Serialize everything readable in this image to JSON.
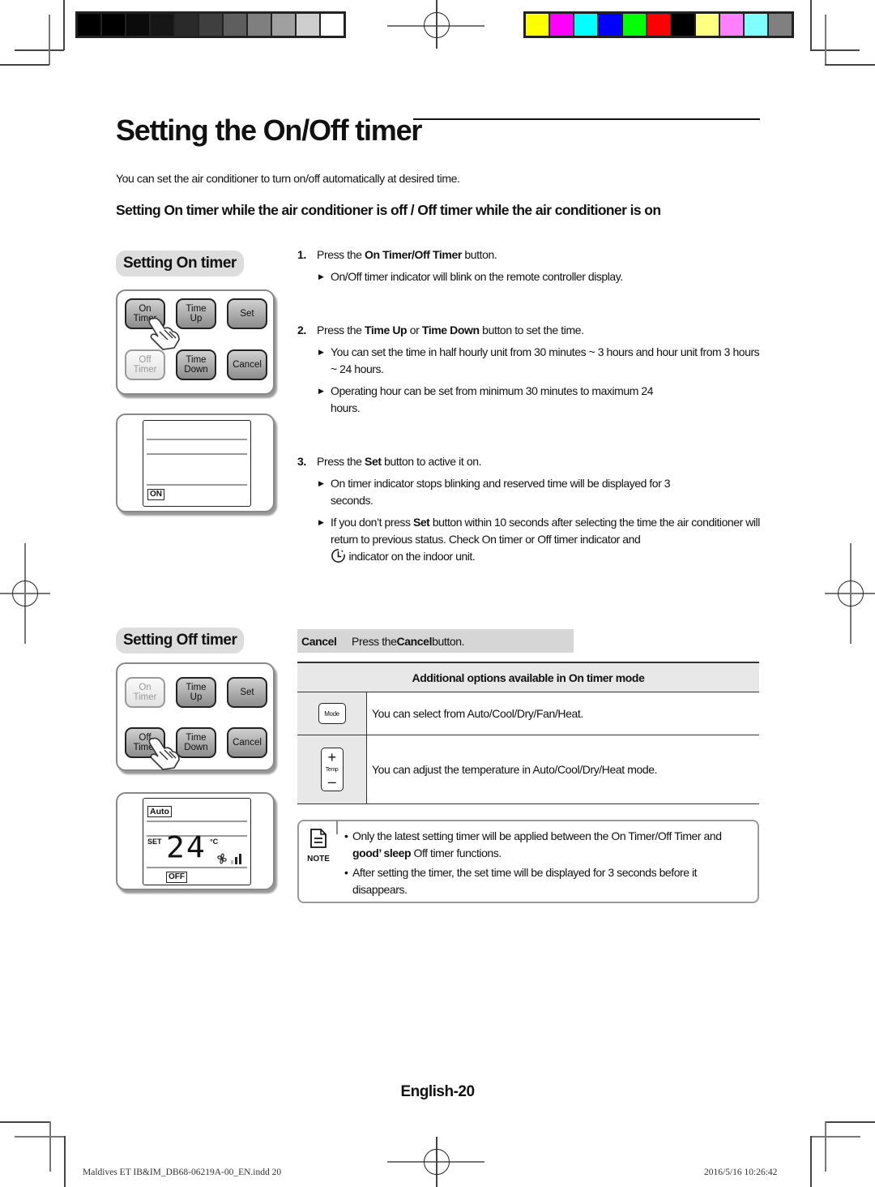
{
  "print_marks": {
    "grayscale_swatches": [
      "#000000",
      "#000000",
      "#0b0b0b",
      "#161616",
      "#2a2a2a",
      "#3f3f3f",
      "#5e5e5e",
      "#7f7f7f",
      "#a0a0a0",
      "#cecece",
      "#ffffff"
    ],
    "color_swatches": [
      "#ffff00",
      "#ff00ff",
      "#00ffff",
      "#0000ff",
      "#00ff00",
      "#ff0000",
      "#000000",
      "#ffff80",
      "#ff80ff",
      "#80ffff",
      "#808080"
    ]
  },
  "page": {
    "title": "Setting the On/Off timer",
    "intro": "You can set the air conditioner to turn on/off automatically at desired time.",
    "subheading": "Setting On timer while the air conditioner is off / Off timer while the air conditioner is on"
  },
  "on_timer": {
    "label": "Setting On timer",
    "buttons": [
      {
        "line1": "On",
        "line2": "Timer"
      },
      {
        "line1": "Time",
        "line2": "Up"
      },
      {
        "line1": "Set",
        "line2": ""
      },
      {
        "line1": "Off",
        "line2": "Timer"
      },
      {
        "line1": "Time",
        "line2": "Down"
      },
      {
        "line1": "Cancel",
        "line2": ""
      }
    ],
    "display_indicator": "ON"
  },
  "off_timer": {
    "label": "Setting Off timer",
    "buttons": [
      {
        "line1": "On",
        "line2": "Timer"
      },
      {
        "line1": "Time",
        "line2": "Up"
      },
      {
        "line1": "Set",
        "line2": ""
      },
      {
        "line1": "Off",
        "line2": "Timer"
      },
      {
        "line1": "Time",
        "line2": "Down"
      },
      {
        "line1": "Cancel",
        "line2": ""
      }
    ],
    "display": {
      "mode": "Auto",
      "set_label": "SET",
      "temperature": "24",
      "unit": "°C",
      "indicator": "OFF"
    }
  },
  "steps": [
    {
      "number": "1.",
      "pre": "Press the ",
      "bold": "On Timer/Off Timer",
      "mid": "",
      "bold2": "",
      "post": " button.",
      "bullets": [
        "On/Off timer indicator will blink on the remote controller display."
      ]
    },
    {
      "number": "2.",
      "pre": "Press the ",
      "bold": "Time Up",
      "mid": " or ",
      "bold2": "Time Down",
      "post": " button to set the time.",
      "bullets": [
        "You can set the time in half hourly unit from 30 minutes ~ 3 hours and hour unit from 3 hours ~ 24 hours.",
        "Operating hour can be set from minimum 30 minutes to maximum 24 hours."
      ]
    },
    {
      "number": "3.",
      "pre": "Press the ",
      "bold": "Set",
      "mid": "",
      "bold2": "",
      "post": " button to active it on.",
      "bullets": [
        "On timer indicator stops blinking and reserved time will be displayed for 3 seconds.",
        {
          "pre": "If you don’t press ",
          "bold": "Set",
          "post": " button within 10 seconds after selecting the time the air conditioner will return to previous status. Check On timer or Off timer indicator and",
          "tail": " indicator on the indoor unit."
        }
      ]
    }
  ],
  "cancel": {
    "label": "Cancel",
    "pre": "Press the ",
    "bold": "Cancel",
    "post": " button."
  },
  "options_table": {
    "header": "Additional options available in On timer mode",
    "rows": [
      {
        "icon": "mode-key",
        "key_label": "Mode",
        "text": "You can select from Auto/Cool/Dry/Fan/Heat."
      },
      {
        "icon": "temp-key",
        "key_label": "Temp",
        "plus": "+",
        "minus": "–",
        "text": "You can adjust the temperature in Auto/Cool/Dry/Heat mode."
      }
    ]
  },
  "note": {
    "label": "NOTE",
    "items": [
      {
        "pre": "Only the latest setting timer will be applied between the On Timer/Off Timer and ",
        "bold": "good’ sleep",
        "post": " Off timer functions."
      },
      {
        "pre": "After setting the timer, the set time will be displayed for 3 seconds before it disappears.",
        "bold": "",
        "post": ""
      }
    ]
  },
  "page_number": "English-20",
  "footer": {
    "file": "Maldives ET IB&IM_DB68-06219A-00_EN.indd   20",
    "timestamp": "2016/5/16   10:26:42"
  }
}
